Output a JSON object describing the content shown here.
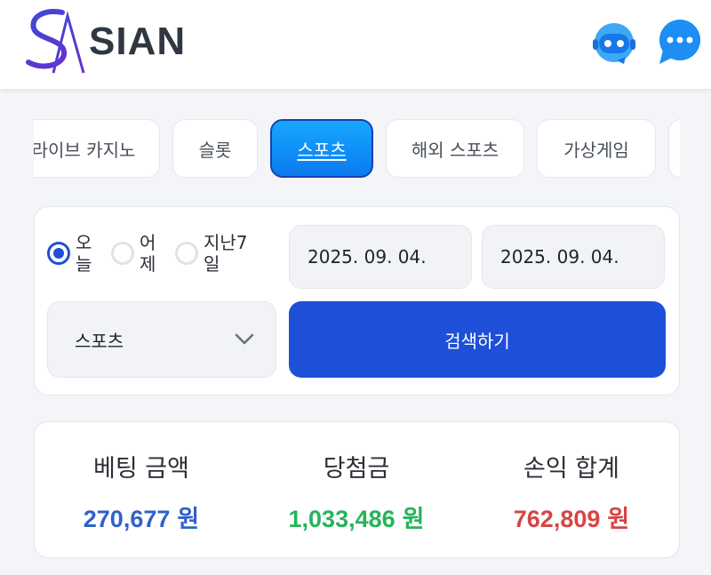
{
  "header": {
    "brand": "SIAN",
    "icons": [
      "bot-icon",
      "chat-bubble-icon"
    ]
  },
  "tabs": [
    {
      "label": "라이브 카지노"
    },
    {
      "label": "슬롯"
    },
    {
      "label": "스포츠",
      "active": true
    },
    {
      "label": "해외 스포츠"
    },
    {
      "label": "가상게임"
    },
    {
      "label": ""
    }
  ],
  "filter": {
    "period_options": [
      {
        "label": "오늘",
        "checked": true
      },
      {
        "label": "어제",
        "checked": false
      },
      {
        "label": "지난7일",
        "checked": false
      }
    ],
    "start_date": "2025. 09. 04.",
    "end_date": "2025. 09. 04.",
    "category_selected": "스포츠",
    "search_label": "검색하기"
  },
  "summary": {
    "bet_label": "베팅 금액",
    "bet_value": "270,677",
    "win_label": "당첨금",
    "win_value": "1,033,486",
    "profit_label": "손익 합계",
    "profit_value": "762,809",
    "unit": "원",
    "colors": {
      "bet": "#2f62c8",
      "win": "#27b35a",
      "profit": "#d64545"
    }
  }
}
